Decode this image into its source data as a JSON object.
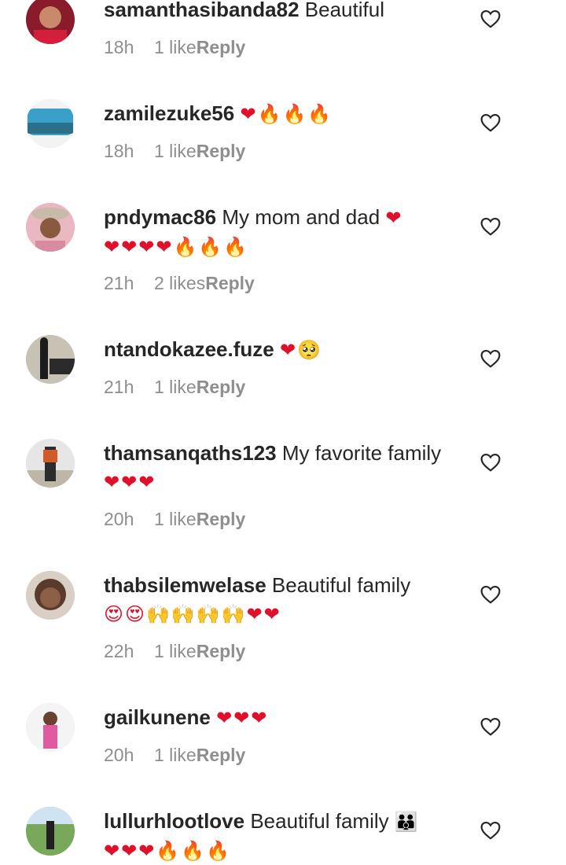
{
  "comments": [
    {
      "user": "samanthasibanda82",
      "text": "Beautiful",
      "emojis": "",
      "emojis2": "",
      "time": "18h",
      "likes": "1 like",
      "reply": "Reply"
    },
    {
      "user": "zamilezuke56",
      "text": "",
      "emojis": "❤🔥🔥🔥",
      "emojis2": "",
      "time": "18h",
      "likes": "1 like",
      "reply": "Reply"
    },
    {
      "user": "pndymac86",
      "text": "My mom and dad",
      "emojis": "❤",
      "emojis2": "❤❤❤❤🔥🔥🔥",
      "time": "21h",
      "likes": "2 likes",
      "reply": "Reply"
    },
    {
      "user": "ntandokazee.fuze",
      "text": "",
      "emojis": "❤🥺",
      "emojis2": "",
      "time": "21h",
      "likes": "1 like",
      "reply": "Reply"
    },
    {
      "user": "thamsanqaths123",
      "text": "My favorite family",
      "emojis": "❤❤❤",
      "emojis2": "",
      "time": "20h",
      "likes": "1 like",
      "reply": "Reply"
    },
    {
      "user": "thabsilemwelase",
      "text": "Beautiful family",
      "emojis": "",
      "emojis2": "😍😍🙌🙌🙌🙌❤❤",
      "time": "22h",
      "likes": "1 like",
      "reply": "Reply"
    },
    {
      "user": "gailkunene",
      "text": "",
      "emojis": "❤❤❤",
      "emojis2": "",
      "time": "20h",
      "likes": "1 like",
      "reply": "Reply"
    },
    {
      "user": "lullurhlootlove",
      "text": "Beautiful family",
      "emojis": "👪",
      "emojis2": "❤❤❤🔥🔥🔥",
      "time": "",
      "likes": "",
      "reply": ""
    }
  ],
  "icons": {
    "like": "heart-outline-icon"
  },
  "colors": {
    "text": "#262626",
    "muted": "#8e8e8e",
    "heart_emoji": "#e0102a"
  }
}
